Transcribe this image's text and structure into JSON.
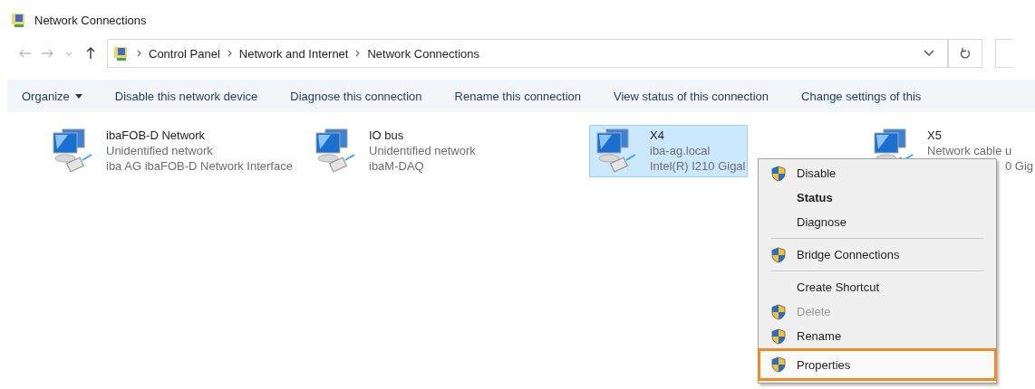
{
  "window": {
    "title": "Network Connections"
  },
  "address_bar": {
    "crumbs": [
      "Control Panel",
      "Network and Internet",
      "Network Connections"
    ]
  },
  "toolbar": [
    {
      "label": "Organize",
      "dropdown": true
    },
    {
      "label": "Disable this network device",
      "dropdown": false
    },
    {
      "label": "Diagnose this connection",
      "dropdown": false
    },
    {
      "label": "Rename this connection",
      "dropdown": false
    },
    {
      "label": "View status of this connection",
      "dropdown": false
    },
    {
      "label": "Change settings of this",
      "dropdown": false
    }
  ],
  "connections": [
    {
      "name": "ibaFOB-D Network",
      "status": "Unidentified network",
      "device": "iba AG ibaFOB-D Network Interface",
      "selected": false,
      "device_covered": false
    },
    {
      "name": "IO bus",
      "status": "Unidentified network",
      "device": "ibaM-DAQ",
      "selected": false,
      "device_covered": false
    },
    {
      "name": "X4",
      "status": "iba-ag.local",
      "device": "Intel(R) I210 Gigal",
      "selected": true,
      "device_covered": false
    },
    {
      "name": "X5",
      "status": "Network cable u",
      "device": "0 Gig",
      "selected": false,
      "device_covered": true
    }
  ],
  "context_menu": [
    {
      "kind": "item",
      "label": "Disable",
      "shield": true,
      "bold": false,
      "disabled": false,
      "highlighted": false
    },
    {
      "kind": "item",
      "label": "Status",
      "shield": false,
      "bold": true,
      "disabled": false,
      "highlighted": false
    },
    {
      "kind": "item",
      "label": "Diagnose",
      "shield": false,
      "bold": false,
      "disabled": false,
      "highlighted": false
    },
    {
      "kind": "separator"
    },
    {
      "kind": "item",
      "label": "Bridge Connections",
      "shield": true,
      "bold": false,
      "disabled": false,
      "highlighted": false
    },
    {
      "kind": "separator"
    },
    {
      "kind": "item",
      "label": "Create Shortcut",
      "shield": false,
      "bold": false,
      "disabled": false,
      "highlighted": false
    },
    {
      "kind": "item",
      "label": "Delete",
      "shield": true,
      "bold": false,
      "disabled": true,
      "highlighted": false
    },
    {
      "kind": "item",
      "label": "Rename",
      "shield": true,
      "bold": false,
      "disabled": false,
      "highlighted": false
    },
    {
      "kind": "item",
      "label": "Properties",
      "shield": true,
      "bold": false,
      "disabled": false,
      "highlighted": true
    }
  ]
}
